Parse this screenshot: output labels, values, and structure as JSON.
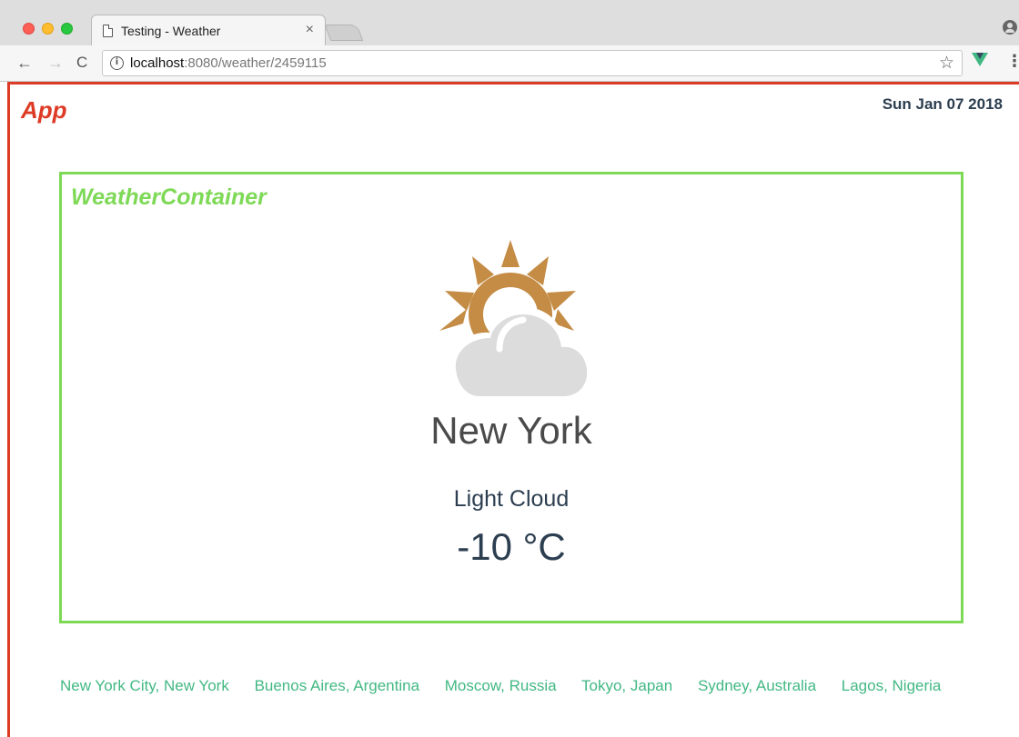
{
  "browser": {
    "tab_title": "Testing - Weather",
    "tab_close": "×",
    "url_host": "localhost",
    "url_path": ":8080/weather/2459115",
    "icons": [
      "page-icon",
      "close-icon",
      "back-icon",
      "forward-icon",
      "reload-icon",
      "info-icon",
      "star-icon",
      "vue-devtools-icon",
      "more-menu-icon",
      "profile-icon"
    ]
  },
  "app": {
    "label": "App",
    "date": "Sun Jan 07 2018",
    "colors": {
      "app_border": "#de3b27",
      "container_border": "#7ed957",
      "link": "#42b883"
    }
  },
  "weather": {
    "container_label": "WeatherContainer",
    "icon": "light-cloud-icon",
    "city": "New York",
    "description": "Light Cloud",
    "temperature": "-10 °C"
  },
  "city_links": [
    "New York City, New York",
    "Buenos Aires, Argentina",
    "Moscow, Russia",
    "Tokyo, Japan",
    "Sydney, Australia",
    "Lagos, Nigeria"
  ]
}
